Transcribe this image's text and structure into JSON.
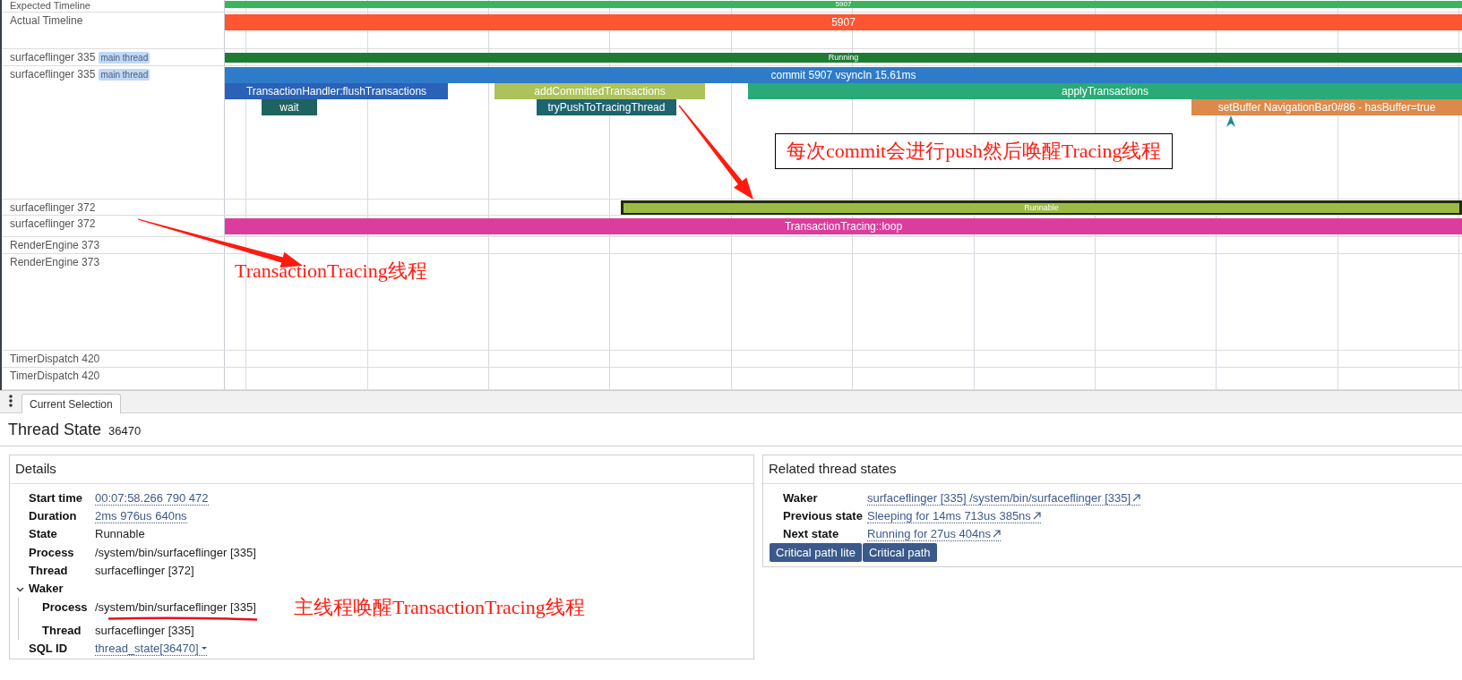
{
  "tracks": [
    {
      "label": "Expected Timeline",
      "slices": [
        {
          "label": "5907",
          "color": "#3bb55b",
          "selected": false
        }
      ]
    },
    {
      "label": "Actual Timeline",
      "slices": [
        {
          "label": "5907",
          "color": "#fe5532",
          "selected": false
        }
      ]
    },
    {
      "label": "surfaceflinger 335",
      "badge": "main thread",
      "slices": [
        {
          "label": "Running",
          "color": "#1e7b34",
          "selected": false
        }
      ]
    },
    {
      "label": "surfaceflinger 335",
      "badge": "main thread",
      "slices": [
        {
          "label": "commit 5907 vsyncIn 15.61ms",
          "color": "#2e7bc9",
          "selected": false,
          "children": [
            {
              "label": "TransactionHandler:flushTransactions",
              "color": "#2a62b8",
              "selected": false,
              "children": [
                {
                  "label": "wait",
                  "color": "#1f6360",
                  "selected": false
                }
              ]
            },
            {
              "label": "addCommittedTransactions",
              "color": "#adc25b",
              "selected": false,
              "children": [
                {
                  "label": "tryPushToTracingThread",
                  "color": "#1d6370",
                  "selected": false
                }
              ]
            },
            {
              "label": "applyTransactions",
              "color": "#2aaa78",
              "selected": false,
              "children": [
                {
                  "label": "setBuffer NavigationBar0#86 - hasBuffer=true",
                  "color": "#dc8a4c",
                  "selected": false
                }
              ]
            }
          ]
        }
      ]
    },
    {
      "label": "surfaceflinger 372",
      "slices": [
        {
          "label": "Runnable",
          "color": "#9cbb43",
          "selected": true
        }
      ]
    },
    {
      "label": "surfaceflinger 372",
      "slices": [
        {
          "label": "TransactionTracing::loop",
          "color": "#dc3d9c",
          "selected": false
        }
      ]
    },
    {
      "label": "RenderEngine 373"
    },
    {
      "label": "RenderEngine 373"
    },
    {
      "label": "TimerDispatch 420"
    },
    {
      "label": "TimerDispatch 420"
    }
  ],
  "tabs": [
    {
      "label": "Current Selection",
      "selected": true
    }
  ],
  "selection": {
    "title": "Thread State",
    "id": "36470"
  },
  "details": {
    "title": "Details",
    "rows": [
      {
        "label": "Start time",
        "value": "00:07:58.266 790 472",
        "kind": "link"
      },
      {
        "label": "Duration",
        "value": "2ms 976us 640ns",
        "kind": "link"
      },
      {
        "label": "State",
        "value": "Runnable",
        "kind": "plain"
      },
      {
        "label": "Process",
        "value": "/system/bin/surfaceflinger [335]",
        "kind": "plain"
      },
      {
        "label": "Thread",
        "value": "surfaceflinger [372]",
        "kind": "plain"
      },
      {
        "label": "Waker",
        "kind": "group",
        "expanded": true,
        "children": [
          {
            "label": "Process",
            "value": "/system/bin/surfaceflinger [335]",
            "kind": "plain"
          },
          {
            "label": "Thread",
            "value": "surfaceflinger [335]",
            "kind": "plain"
          }
        ]
      },
      {
        "label": "SQL ID",
        "value": "thread_state[36470]",
        "kind": "menu_link"
      }
    ]
  },
  "related": {
    "title": "Related thread states",
    "rows": [
      {
        "label": "Waker",
        "value": "surfaceflinger [335] /system/bin/surfaceflinger [335]"
      },
      {
        "label": "Previous state",
        "value": "Sleeping for 14ms 713us 385ns"
      },
      {
        "label": "Next state",
        "value": "Running for 27us 404ns"
      }
    ],
    "buttons": [
      "Critical path lite",
      "Critical path"
    ]
  },
  "annotations": [
    {
      "kind": "boxed",
      "text": "每次commit会进行push然后唤醒Tracing线程"
    },
    {
      "kind": "plain",
      "text": "TransactionTracing线程"
    },
    {
      "kind": "plain",
      "text": "主线程唤醒TransactionTracing线程"
    }
  ]
}
